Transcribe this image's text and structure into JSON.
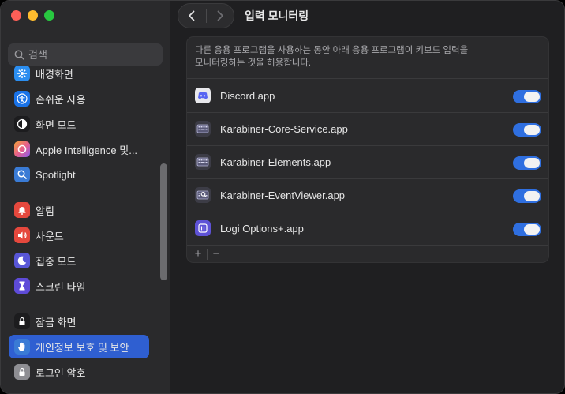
{
  "search": {
    "placeholder": "검색"
  },
  "sidebar": {
    "items": [
      {
        "label": "배경화면",
        "icon": "wallpaper-icon",
        "color": "#2b8ef0"
      },
      {
        "label": "손쉬운 사용",
        "icon": "accessibility-icon",
        "color": "#1a73e8"
      },
      {
        "label": "화면 모드",
        "icon": "appearance-icon",
        "color": "#1c1c1e"
      },
      {
        "label": "Apple Intelligence 및...",
        "icon": "apple-intelligence-icon",
        "color": "#e8608a"
      },
      {
        "label": "Spotlight",
        "icon": "spotlight-icon",
        "color": "#3a7bd5"
      },
      {
        "label": "알림",
        "icon": "notifications-icon",
        "color": "#e5483d"
      },
      {
        "label": "사운드",
        "icon": "sound-icon",
        "color": "#e5483d"
      },
      {
        "label": "집중 모드",
        "icon": "focus-icon",
        "color": "#5856d6"
      },
      {
        "label": "스크린 타임",
        "icon": "screen-time-icon",
        "color": "#5e4bd8"
      },
      {
        "label": "잠금 화면",
        "icon": "lock-screen-icon",
        "color": "#1c1c1e"
      },
      {
        "label": "개인정보 보호 및 보안",
        "icon": "privacy-hand-icon",
        "color": "#3a7bd5"
      },
      {
        "label": "로그인 암호",
        "icon": "login-password-icon",
        "color": "#8e8e93"
      }
    ],
    "active_index": 10
  },
  "header": {
    "title": "입력 모니터링"
  },
  "panel": {
    "description_line1": "다른 응용 프로그램을 사용하는 동안 아래 응용 프로그램이 키보드 입력을",
    "description_line2": "모니터링하는 것을 허용합니다.",
    "apps": [
      {
        "name": "Discord.app",
        "icon": "discord-icon",
        "enabled": true
      },
      {
        "name": "Karabiner-Core-Service.app",
        "icon": "karabiner-icon",
        "enabled": true
      },
      {
        "name": "Karabiner-Elements.app",
        "icon": "karabiner-icon",
        "enabled": true
      },
      {
        "name": "Karabiner-EventViewer.app",
        "icon": "karabiner-eventviewer-icon",
        "enabled": true
      },
      {
        "name": "Logi Options+.app",
        "icon": "logi-options-icon",
        "enabled": true
      }
    ],
    "add_label": "+",
    "remove_label": "−"
  },
  "colors": {
    "accent": "#2f6fe0",
    "sidebar_active": "#2f5fd1"
  }
}
